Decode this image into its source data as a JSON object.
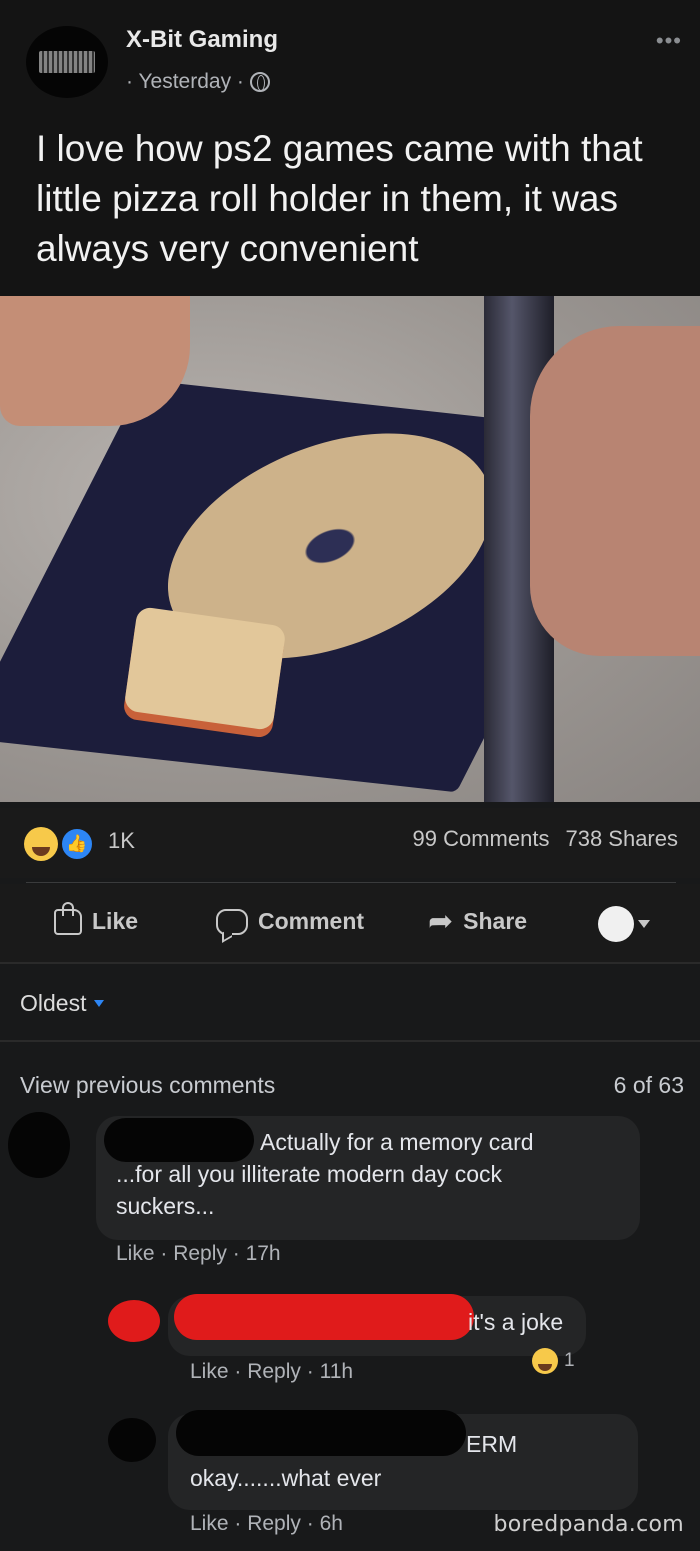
{
  "post": {
    "page_name": "X-Bit Gaming",
    "time": "· Yesterday ·",
    "more_icon": "•••",
    "text": "I love how ps2 games came with that little pizza roll holder in them, it was always very convenient"
  },
  "reactions": {
    "count": "1K",
    "comments": "99 Comments",
    "shares": "738 Shares",
    "icons": [
      "haha-reaction-icon",
      "like-reaction-icon"
    ]
  },
  "actions": {
    "like": "Like",
    "comment": "Comment",
    "share": "Share"
  },
  "comments_section": {
    "sort_label": "Oldest",
    "view_previous": "View previous comments",
    "page_count": "6 of 63"
  },
  "comments": [
    {
      "text": "Actually for a memory card",
      "text_line2": "...for all you illiterate modern day cock",
      "text_line3": "suckers...",
      "like": "Like",
      "reply": "Reply",
      "time": "17h"
    },
    {
      "text": "it's a joke",
      "like": "Like",
      "reply": "Reply",
      "time": "11h",
      "reaction_count": "1"
    },
    {
      "text": "ERM",
      "text_line2": "okay.......what ever",
      "like": "Like",
      "reply": "Reply",
      "time": "6h"
    }
  ],
  "watermark": "boredpanda.com",
  "colors": {
    "background": "#18191a",
    "accent_blue": "#2d86f5",
    "redaction_red": "#e01b1b"
  }
}
